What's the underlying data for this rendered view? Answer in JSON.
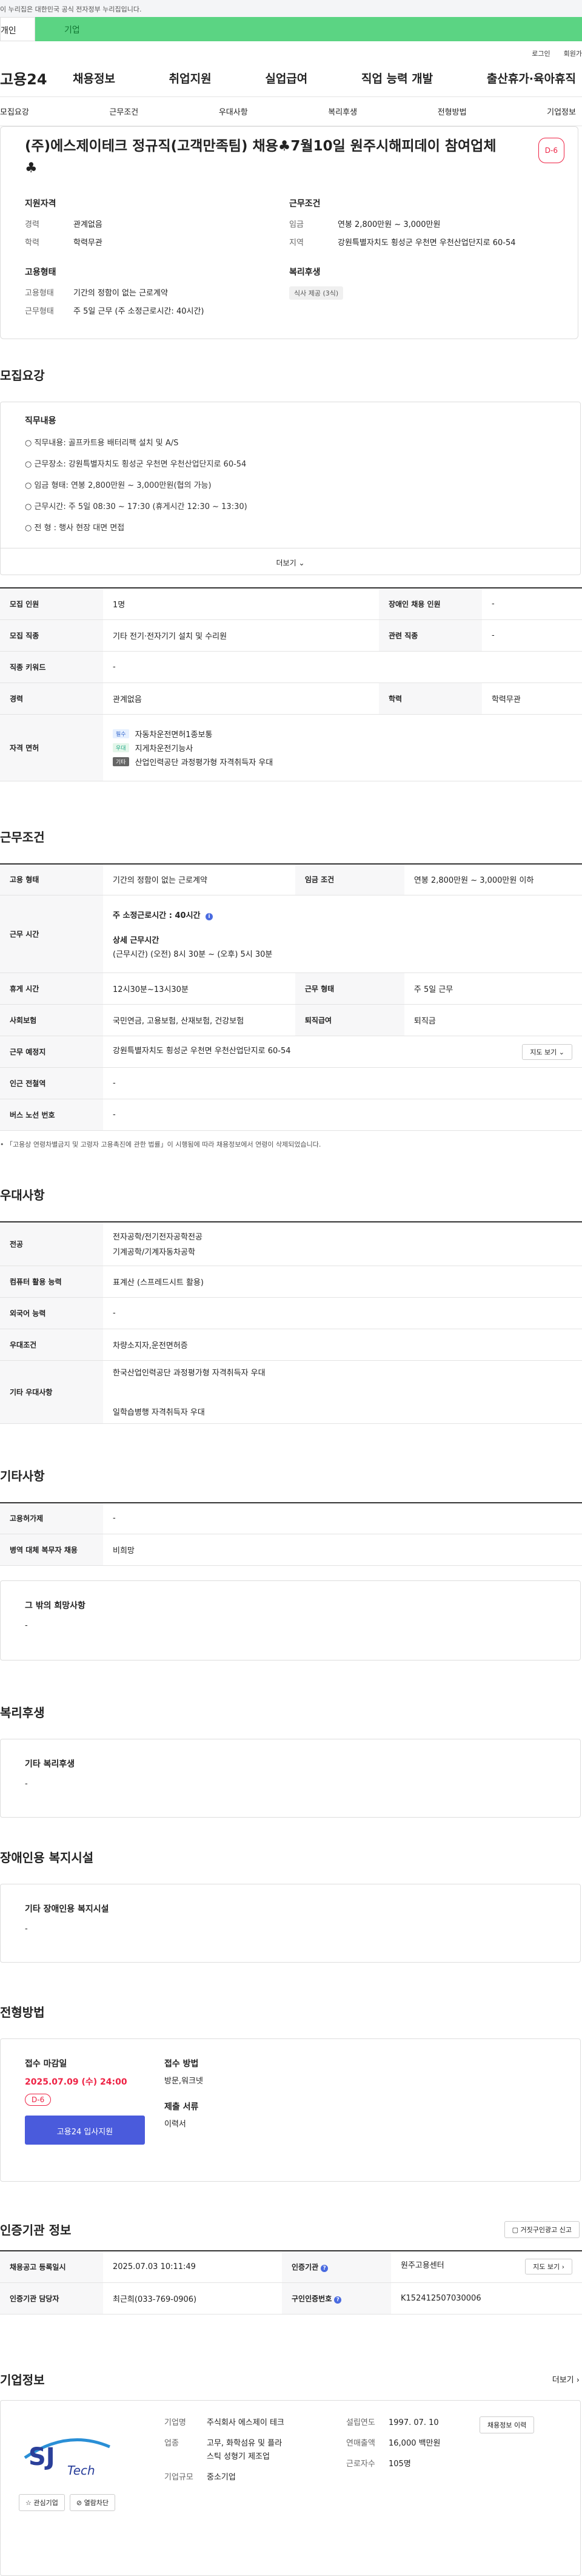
{
  "topbar": {
    "notice": "이 누리집은 대한민국 공식 전자정부 누리집입니다."
  },
  "audience_tabs": {
    "individual": "개인",
    "business": "기업"
  },
  "util_links": {
    "login": "로그인",
    "signup": "회원가"
  },
  "gnb": {
    "logo": "고용24",
    "menu": [
      "채용정보",
      "취업지원",
      "실업급여",
      "직업 능력 개발",
      "출산휴가·육아휴직"
    ]
  },
  "subnav": [
    "모집요강",
    "근무조건",
    "우대사항",
    "복리후생",
    "전형방법",
    "기업정보"
  ],
  "summary": {
    "title": "(주)에스제이테크 정규직(고객만족팀) 채용♣7월10일 원주시해피데이 참여업체 ♣",
    "dday": "D-6",
    "qual": {
      "heading": "지원자격",
      "rows": [
        {
          "k": "경력",
          "v": "관계없음"
        },
        {
          "k": "학력",
          "v": "학력무관"
        }
      ]
    },
    "cond": {
      "heading": "근무조건",
      "rows": [
        {
          "k": "임금",
          "v": "연봉 2,800만원 ~ 3,000만원"
        },
        {
          "k": "지역",
          "v": "강원특별자치도 횡성군 우천면 우천산업단지로 60-54"
        }
      ]
    },
    "emp": {
      "heading": "고용형태",
      "rows": [
        {
          "k": "고용형태",
          "v": "기간의 정함이 없는 근로계약"
        },
        {
          "k": "근무형태",
          "v": "주 5일 근무 (주 소정근로시간: 40시간)"
        }
      ]
    },
    "benefit": {
      "heading": "복리후생",
      "tag": "식사 제공 (3식)"
    }
  },
  "recruit": {
    "title": "모집요강",
    "duty_heading": "직무내용",
    "duty_lines": [
      "○ 직무내용: 골프카트용 배터리팩 설치 및 A/S",
      "○ 근무장소: 강원특별자치도 횡성군 우천면 우천산업단지로 60-54",
      "○ 임금 형태: 연봉 2,800만원 ~ 3,000만원(협의 가능)",
      "○ 근무시간: 주 5일 08:30 ~ 17:30 (휴게시간 12:30 ~ 13:30)",
      "○ 전 형 : 행사 현장 대면 면접"
    ],
    "more": "더보기",
    "table": {
      "headcount_k": "모집 인원",
      "headcount_v": "1명",
      "disabled_k": "장애인 채용 인원",
      "disabled_v": "-",
      "job_k": "모집 직종",
      "job_v": "기타 전기·전자기기 설치 및 수리원",
      "rel_k": "관련 직종",
      "rel_v": "-",
      "kw_k": "직종 키워드",
      "kw_v": "-",
      "exp_k": "경력",
      "exp_v": "관계없음",
      "edu_k": "학력",
      "edu_v": "학력무관",
      "lic_k": "자격 면허",
      "licenses": [
        {
          "badge": "필수",
          "name": "자동차운전면허1종보통"
        },
        {
          "badge": "우대",
          "name": "지게차운전기능사"
        },
        {
          "badge": "기타",
          "name": "산업인력공단 과정평가형 자격취득자 우대"
        }
      ]
    }
  },
  "work": {
    "title": "근무조건",
    "emp_k": "고용 형태",
    "emp_v": "기간의 정함이 없는 근로계약",
    "wage_k": "임금 조건",
    "wage_v": "연봉 2,800만원 ~ 3,000만원 이하",
    "hours_k": "근무 시간",
    "hours_main": "주 소정근로시간 : 40시간",
    "hours_detail_h": "상세 근무시간",
    "hours_detail": "(근무시간) (오전) 8시 30분 ~ (오후) 5시 30분",
    "rest_k": "휴게 시간",
    "rest_v": "12시30분~13시30분",
    "type_k": "근무 형태",
    "type_v": "주 5일 근무",
    "ins_k": "사회보험",
    "ins_v": "국민연금, 고용보험, 산재보험, 건강보험",
    "ret_k": "퇴직급여",
    "ret_v": "퇴직금",
    "loc_k": "근무 예정지",
    "loc_v": "강원특별자치도 횡성군 우천면 우천산업단지로 60-54",
    "map": "지도 보기",
    "sub_k": "인근 전철역",
    "sub_v": "-",
    "bus_k": "버스 노선 번호",
    "bus_v": "-",
    "note": "「고용상 연령차별금지 및 고령자 고용촉진에 관한 법률」이 시행됨에 따라 채용정보에서 연령이 삭제되었습니다."
  },
  "pref": {
    "title": "우대사항",
    "major_k": "전공",
    "majors": [
      "전자공학/전기전자공학전공",
      "기계공학/기계자동차공학"
    ],
    "pc_k": "컴퓨터 활용 능력",
    "pc_v": "표계산 (스프레드시트 활용)",
    "lang_k": "외국어 능력",
    "lang_v": "-",
    "cond_k": "우대조건",
    "cond_v": "차량소지자,운전면허증",
    "etc_k": "기타 우대사항",
    "etc_lines": [
      "한국산업인력공단 과정평가형 자격취득자 우대",
      "일학습병행 자격취득자 우대"
    ]
  },
  "other": {
    "title": "기타사항",
    "ins_k": "고용허가제",
    "ins_v": "-",
    "mil_k": "병역 대체 복무자 채용",
    "mil_v": "비희망",
    "wish_h": "그 밖의 희망사항",
    "wish_v": "-"
  },
  "welfare": {
    "title": "복리후생",
    "h": "기타 복리후생",
    "v": "-"
  },
  "disabled": {
    "title": "장애인용 복지시설",
    "h": "기타 장애인용 복지시설",
    "v": "-"
  },
  "selection": {
    "title": "전형방법",
    "deadline_h": "접수 마감일",
    "deadline": "2025.07.09 (수) 24:00",
    "dday": "D-6",
    "apply": "고용24 입사지원",
    "method_h": "접수 방법",
    "method_v": "방문,워크넷",
    "docs_h": "제출 서류",
    "docs_v": "이력서"
  },
  "cert": {
    "title": "인증기관 정보",
    "report": "거짓구인광고 신고",
    "reg_k": "채용공고 등록일시",
    "reg_v": "2025.07.03 10:11:49",
    "org_k": "인증기관",
    "org_v": "원주고용센터",
    "map": "지도 보기",
    "mgr_k": "인증기관 담당자",
    "mgr_v": "최근희(033-769-0906)",
    "no_k": "구인인증번호",
    "no_v": "K152412507030006"
  },
  "company": {
    "title": "기업정보",
    "more": "더보기",
    "logo_sj": "SJ",
    "logo_tech": "Tech",
    "interest": "관심기업",
    "block": "열람차단",
    "name_k": "기업명",
    "name_v": "주식회사 에스제이 테크",
    "ind_k": "업종",
    "ind_v": "고무, 화학섬유 및 플라스틱 성형기 제조업",
    "size_k": "기업규모",
    "size_v": "중소기업",
    "est_k": "설립연도",
    "est_v": "1997. 07. 10",
    "sales_k": "연매출액",
    "sales_v": "16,000 백만원",
    "emp_k": "근로자수",
    "emp_v": "105명",
    "jobs": "채용정보 이력"
  }
}
